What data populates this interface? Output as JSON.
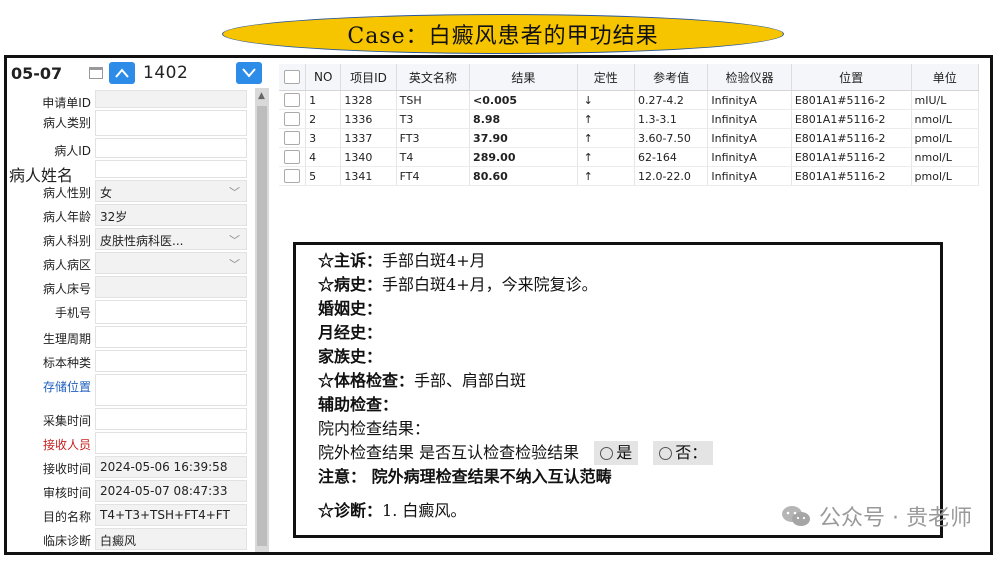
{
  "banner": "Case：白癜风患者的甲功结果",
  "topbar": {
    "date": "05-07",
    "number": "1402"
  },
  "fields": [
    {
      "label": "申请单ID",
      "value": "",
      "style": "",
      "kind": "plain",
      "h": 20
    },
    {
      "label": "病人类别",
      "value": "",
      "style": "",
      "kind": "white",
      "h": 28
    },
    {
      "label": "病人ID",
      "value": "",
      "style": "",
      "kind": "white",
      "h": 22
    },
    {
      "label": "病人姓名",
      "value": "",
      "style": "big",
      "kind": "white",
      "h": 20
    },
    {
      "label": "病人性别",
      "value": "女",
      "style": "",
      "kind": "select",
      "h": 24
    },
    {
      "label": "病人年龄",
      "value": "32岁",
      "style": "",
      "kind": "plain",
      "h": 24
    },
    {
      "label": "病人科别",
      "value": "皮肤性病科医...",
      "style": "",
      "kind": "select",
      "h": 24
    },
    {
      "label": "病人病区",
      "value": "",
      "style": "",
      "kind": "select",
      "h": 24
    },
    {
      "label": "病人床号",
      "value": "",
      "style": "",
      "kind": "plain",
      "h": 24
    },
    {
      "label": "手机号",
      "value": "",
      "style": "",
      "kind": "white",
      "h": 26
    },
    {
      "label": "生理周期",
      "value": "",
      "style": "",
      "kind": "white",
      "h": 24
    },
    {
      "label": "标本种类",
      "value": "",
      "style": "",
      "kind": "white",
      "h": 24
    },
    {
      "label": "存储位置",
      "value": "",
      "style": "blue",
      "kind": "white",
      "h": 34
    },
    {
      "label": "采集时间",
      "value": "",
      "style": "",
      "kind": "white",
      "h": 24
    },
    {
      "label": "接收人员",
      "value": "",
      "style": "red",
      "kind": "white",
      "h": 24
    },
    {
      "label": "接收时间",
      "value": "2024-05-06 16:39:58",
      "style": "",
      "kind": "plain",
      "h": 24
    },
    {
      "label": "审核时间",
      "value": "2024-05-07 08:47:33",
      "style": "",
      "kind": "plain",
      "h": 24
    },
    {
      "label": "目的名称",
      "value": "T4+T3+TSH+FT4+FT",
      "style": "",
      "kind": "plain",
      "h": 24
    },
    {
      "label": "临床诊断",
      "value": "白癜风",
      "style": "",
      "kind": "plain",
      "h": 24
    }
  ],
  "table": {
    "headers": [
      "NO",
      "项目ID",
      "英文名称",
      "结果",
      "定性",
      "参考值",
      "检验仪器",
      "位置",
      "单位"
    ],
    "rows": [
      {
        "no": "1",
        "id": "1328",
        "name": "TSH",
        "result": "<0.005",
        "flag": "↓",
        "dir": "low",
        "ref": "0.27-4.2",
        "inst": "InfinityA",
        "pos": "E801A1#5116-2",
        "unit": "mIU/L"
      },
      {
        "no": "2",
        "id": "1336",
        "name": "T3",
        "result": "8.98",
        "flag": "↑",
        "dir": "high",
        "ref": "1.3-3.1",
        "inst": "InfinityA",
        "pos": "E801A1#5116-2",
        "unit": "nmol/L"
      },
      {
        "no": "3",
        "id": "1337",
        "name": "FT3",
        "result": "37.90",
        "flag": "↑",
        "dir": "high",
        "ref": "3.60-7.50",
        "inst": "InfinityA",
        "pos": "E801A1#5116-2",
        "unit": "pmol/L"
      },
      {
        "no": "4",
        "id": "1340",
        "name": "T4",
        "result": "289.00",
        "flag": "↑",
        "dir": "high",
        "ref": "62-164",
        "inst": "InfinityA",
        "pos": "E801A1#5116-2",
        "unit": "nmol/L"
      },
      {
        "no": "5",
        "id": "1341",
        "name": "FT4",
        "result": "80.60",
        "flag": "↑",
        "dir": "high",
        "ref": "12.0-22.0",
        "inst": "InfinityA",
        "pos": "E801A1#5116-2",
        "unit": "pmol/L"
      }
    ]
  },
  "note": {
    "chief_label": "☆主诉：",
    "chief": "手部白斑4+月",
    "history_label": "☆病史：",
    "history": "手部白斑4+月，今来院复诊。",
    "marital_label": "婚姻史：",
    "menstrual_label": "月经史：",
    "family_label": "家族史：",
    "exam_label": "☆体格检查：",
    "exam": "手部、肩部白斑",
    "aux_label": "辅助检查：",
    "inhouse": "院内检查结果：",
    "outside": "院外检查结果 是否互认检查检验结果",
    "opt_yes": "是",
    "opt_no": "否：",
    "attention": "注意： 院外病理检查结果不纳入互认范畴",
    "diag_label": "☆诊断：",
    "diag": "1.  白癜风。"
  },
  "watermark": "公众号 · 贵老师"
}
